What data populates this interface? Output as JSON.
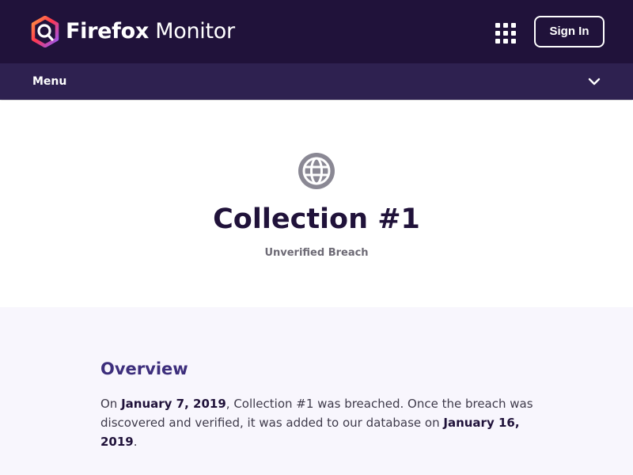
{
  "header": {
    "brand_first": "Firefox",
    "brand_second": "Monitor",
    "signin_label": "Sign In",
    "apps_icon": "apps-grid-icon",
    "logo_icon": "firefox-monitor-logo"
  },
  "menu": {
    "label": "Menu",
    "icon": "chevron-down-icon"
  },
  "breach": {
    "icon": "globe-icon",
    "title": "Collection #1",
    "status": "Unverified Breach"
  },
  "overview": {
    "heading": "Overview",
    "text_1": "On ",
    "breach_date": "January 7, 2019",
    "text_2": ", Collection #1 was breached. Once the breach was discovered and verified, it was added to our database on ",
    "added_date": "January 16, 2019",
    "text_3": "."
  },
  "colors": {
    "header_bg": "#20123a",
    "menubar_bg": "#2e2150",
    "heading_purple": "#3d2e7c",
    "overview_bg": "#f8f6fd"
  }
}
